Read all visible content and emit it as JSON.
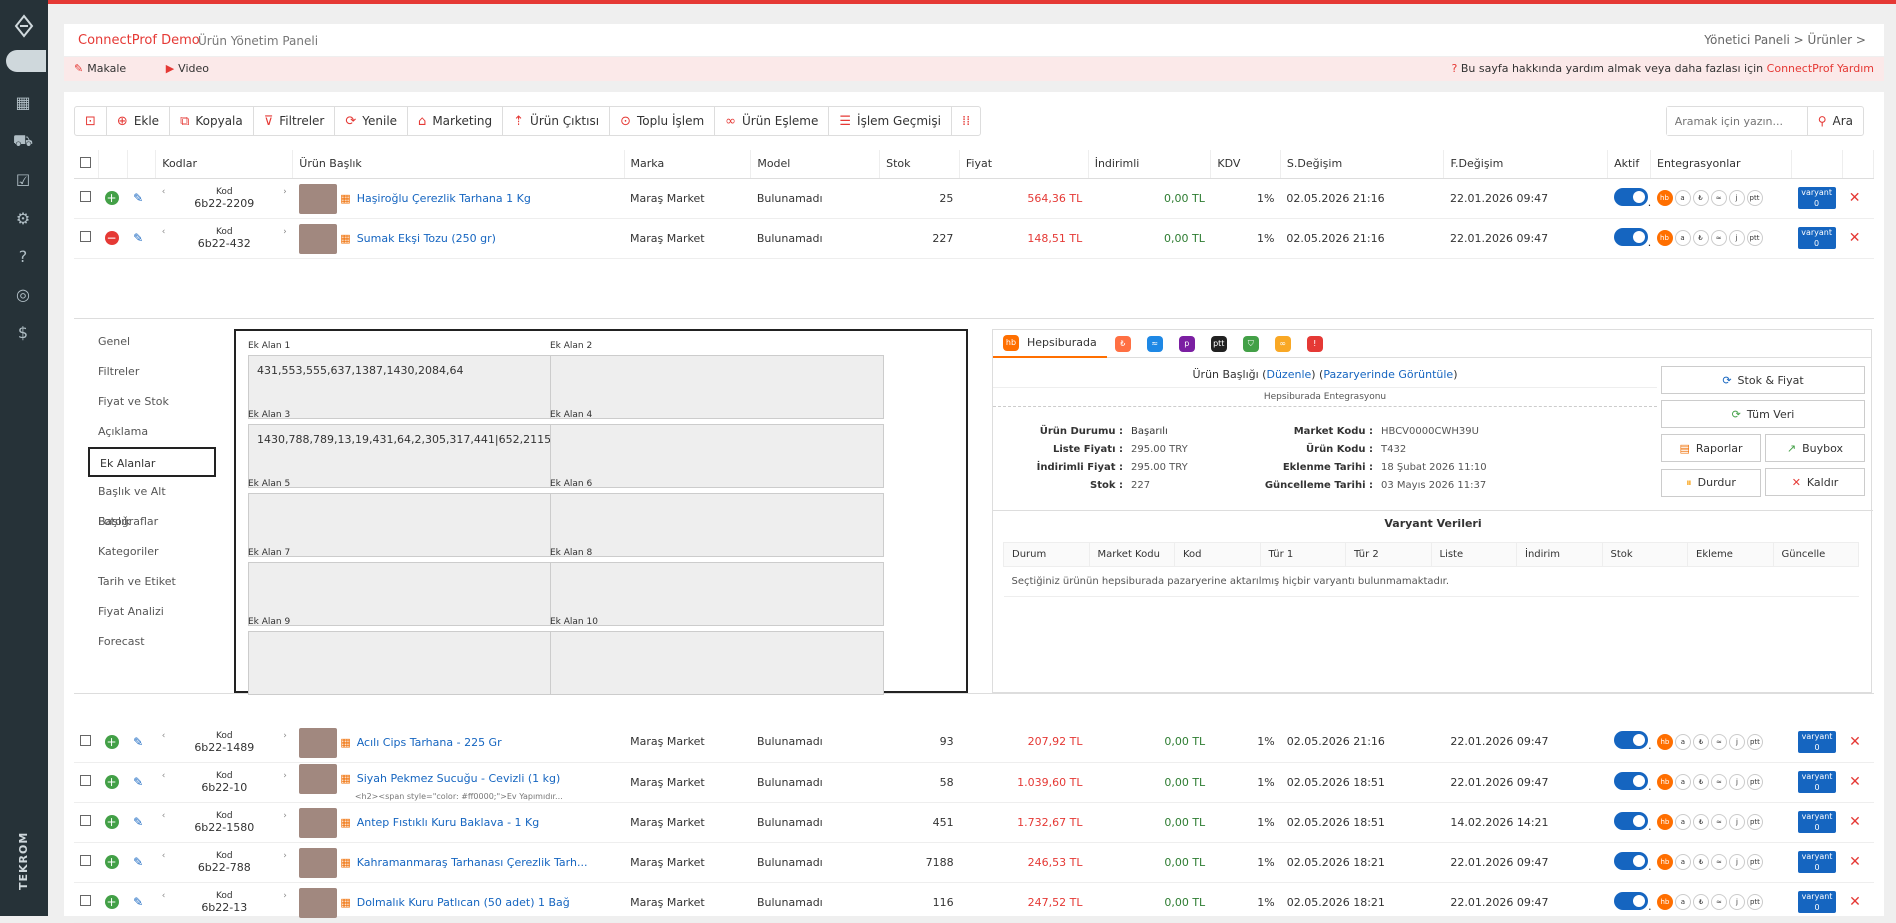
{
  "sidebar": {
    "brand": "TEKROM",
    "icons": [
      "dashboard-icon",
      "cart-icon",
      "checklist-icon",
      "users-settings-icon",
      "help-icon",
      "analytics-icon",
      "currency-icon"
    ]
  },
  "header": {
    "title": "ConnectProf Demo",
    "subtitle": "Ürün Yönetim Paneli",
    "breadcrumb": "Yönetici Paneli > Ürünler >"
  },
  "helpbar": {
    "article": "Makale",
    "video": "Video",
    "help_text": "Bu sayfa hakkında yardım almak veya daha fazlası için",
    "help_link": "ConnectProf Yardım"
  },
  "toolbar": {
    "add": "Ekle",
    "copy": "Kopyala",
    "filters": "Filtreler",
    "refresh": "Yenile",
    "marketing": "Marketing",
    "export": "Ürün Çıktısı",
    "bulk": "Toplu İşlem",
    "match": "Ürün Eşleme",
    "history": "İşlem Geçmişi"
  },
  "search": {
    "placeholder": "Aramak için yazın...",
    "button": "Ara"
  },
  "columns": {
    "codes": "Kodlar",
    "title": "Ürün Başlık",
    "brand": "Marka",
    "model": "Model",
    "stock": "Stok",
    "price": "Fiyat",
    "discounted": "İndirimli",
    "vat": "KDV",
    "modified": "S.Değişim",
    "changed": "F.Değişim",
    "active": "Aktif",
    "integrations": "Entegrasyonlar"
  },
  "rows_top": [
    {
      "code_label": "Kod",
      "code": "6b22-2209",
      "name": "Haşiroğlu Çerezlik Tarhana 1 Kg",
      "sub": "",
      "brand": "Maraş Market",
      "model": "Bulunamadı",
      "stock": "25",
      "price": "564,36 TL",
      "disc": "0,00 TL",
      "vat": "1%",
      "mod": "02.05.2026 21:16",
      "chg": "22.01.2026 09:47",
      "variant": "varyant",
      "vcount": "0"
    },
    {
      "code_label": "Kod",
      "code": "6b22-432",
      "name": "Sumak Ekşi Tozu (250 gr)",
      "sub": "",
      "brand": "Maraş Market",
      "model": "Bulunamadı",
      "stock": "227",
      "price": "148,51 TL",
      "disc": "0,00 TL",
      "vat": "1%",
      "mod": "02.05.2026 21:16",
      "chg": "22.01.2026 09:47",
      "variant": "varyant",
      "vcount": "0"
    }
  ],
  "rows_bottom": [
    {
      "code_label": "Kod",
      "code": "6b22-1489",
      "name": "Acılı Cips Tarhana - 225 Gr",
      "sub": "",
      "brand": "Maraş Market",
      "model": "Bulunamadı",
      "stock": "93",
      "price": "207,92 TL",
      "disc": "0,00 TL",
      "vat": "1%",
      "mod": "02.05.2026 21:16",
      "chg": "22.01.2026 09:47",
      "variant": "varyant",
      "vcount": "0"
    },
    {
      "code_label": "Kod",
      "code": "6b22-10",
      "name": "Siyah Pekmez Sucuğu - Cevizli (1 kg)",
      "sub": "<h2><span style=\"color: #ff0000;\">Ev Yapımıdır...",
      "brand": "Maraş Market",
      "model": "Bulunamadı",
      "stock": "58",
      "price": "1.039,60 TL",
      "disc": "0,00 TL",
      "vat": "1%",
      "mod": "02.05.2026 18:51",
      "chg": "22.01.2026 09:47",
      "variant": "varyant",
      "vcount": "0"
    },
    {
      "code_label": "Kod",
      "code": "6b22-1580",
      "name": "Antep Fıstıklı Kuru Baklava - 1 Kg",
      "sub": "",
      "brand": "Maraş Market",
      "model": "Bulunamadı",
      "stock": "451",
      "price": "1.732,67 TL",
      "disc": "0,00 TL",
      "vat": "1%",
      "mod": "02.05.2026 18:51",
      "chg": "14.02.2026 14:21",
      "variant": "varyant",
      "vcount": "0"
    },
    {
      "code_label": "Kod",
      "code": "6b22-788",
      "name": "Kahramanmaraş Tarhanası Çerezlik Tarh...",
      "sub": "",
      "brand": "Maraş Market",
      "model": "Bulunamadı",
      "stock": "7188",
      "price": "246,53 TL",
      "disc": "0,00 TL",
      "vat": "1%",
      "mod": "02.05.2026 18:21",
      "chg": "22.01.2026 09:47",
      "variant": "varyant",
      "vcount": "0"
    },
    {
      "code_label": "Kod",
      "code": "6b22-13",
      "name": "Dolmalık Kuru Patlıcan (50 adet) 1 Bağ",
      "sub": "",
      "brand": "Maraş Market",
      "model": "Bulunamadı",
      "stock": "116",
      "price": "247,52 TL",
      "disc": "0,00 TL",
      "vat": "1%",
      "mod": "02.05.2026 18:21",
      "chg": "22.01.2026 09:47",
      "variant": "varyant",
      "vcount": "0"
    }
  ],
  "detail_menu": [
    "Genel",
    "Filtreler",
    "Fiyat ve Stok",
    "Açıklama",
    "Ek Alanlar",
    "Başlık ve Alt Başlık",
    "Fotoğraflar",
    "Kategoriler",
    "Tarih ve Etiket",
    "Fiyat Analizi",
    "Forecast"
  ],
  "extra_fields": [
    {
      "label": "Ek Alan 1",
      "value": "431,553,555,637,1387,1430,2084,64"
    },
    {
      "label": "Ek Alan 2",
      "value": ""
    },
    {
      "label": "Ek Alan 3",
      "value": "1430,788,789,13,19,431,64,2,305,317,441|652,2115,645,213"
    },
    {
      "label": "Ek Alan 4",
      "value": ""
    },
    {
      "label": "Ek Alan 5",
      "value": ""
    },
    {
      "label": "Ek Alan 6",
      "value": ""
    },
    {
      "label": "Ek Alan 7",
      "value": ""
    },
    {
      "label": "Ek Alan 8",
      "value": ""
    },
    {
      "label": "Ek Alan 9",
      "value": ""
    },
    {
      "label": "Ek Alan 10",
      "value": ""
    }
  ],
  "market": {
    "tab": "Hepsiburada",
    "head_label": "Ürün Başlığı",
    "edit": "Düzenle",
    "view": "Pazaryerinde Görüntüle",
    "integration": "Hepsiburada Entegrasyonu",
    "left": [
      {
        "k": "Ürün Durumu :",
        "v": "Başarılı"
      },
      {
        "k": "Liste Fiyatı :",
        "v": "295.00 TRY"
      },
      {
        "k": "İndirimli Fiyat :",
        "v": "295.00 TRY"
      },
      {
        "k": "Stok :",
        "v": "227"
      }
    ],
    "right": [
      {
        "k": "Market Kodu :",
        "v": "HBCV0000CWH39U"
      },
      {
        "k": "Ürün Kodu :",
        "v": "T432"
      },
      {
        "k": "Eklenme Tarihi :",
        "v": "18 Şubat 2026 11:10"
      },
      {
        "k": "Güncelleme Tarihi :",
        "v": "03 Mayıs 2026 11:37"
      }
    ],
    "buttons": {
      "stock_price": "Stok & Fiyat",
      "all": "Tüm Veri",
      "reports": "Raporlar",
      "buybox": "Buybox",
      "stop": "Durdur",
      "remove": "Kaldır"
    },
    "variant_title": "Varyant Verileri",
    "variant_cols": [
      "Durum",
      "Market Kodu",
      "Kod",
      "Tür 1",
      "Tür 2",
      "Liste",
      "İndirim",
      "Stok",
      "Ekleme",
      "Güncelle"
    ],
    "variant_empty": "Seçtiğiniz ürünün hepsiburada pazaryerine aktarılmış hiçbir varyantı bulunmamaktadır."
  }
}
